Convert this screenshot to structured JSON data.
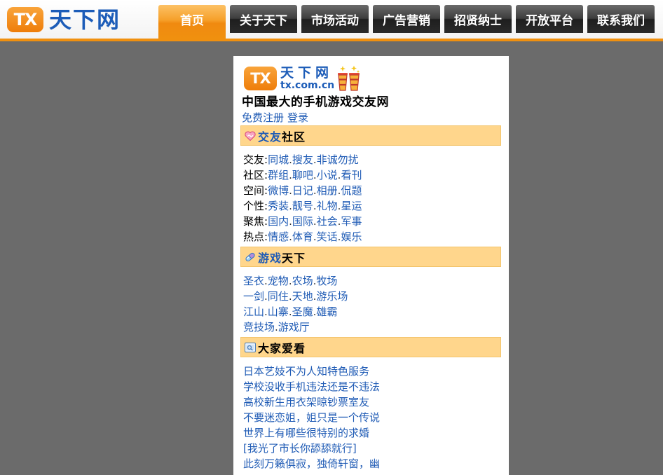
{
  "site": {
    "badge": "TX",
    "name": "天下网"
  },
  "nav": [
    {
      "label": "首页",
      "active": true
    },
    {
      "label": "关于天下"
    },
    {
      "label": "市场活动"
    },
    {
      "label": "广告营销"
    },
    {
      "label": "招贤纳士"
    },
    {
      "label": "开放平台"
    },
    {
      "label": "联系我们"
    }
  ],
  "wap": {
    "logo": {
      "badge": "TX",
      "name": "天下网",
      "domain": "tx.com.cn",
      "icon": "drink-cups-icon"
    },
    "tagline": "中国最大的手机游戏交友网",
    "register": "免费注册",
    "login": "登录",
    "separator": ".",
    "sections": [
      {
        "icon": "heart-icon",
        "title_highlight": "交友",
        "title_rest": "社区",
        "rows": [
          {
            "label": "交友:",
            "links": [
              "同城",
              "搜友",
              "非诚勿扰"
            ]
          },
          {
            "label": "社区:",
            "links": [
              "群组",
              "聊吧",
              "小说",
              "看刊"
            ]
          },
          {
            "label": "空间:",
            "links": [
              "微博",
              "日记",
              "相册",
              "侃题"
            ]
          },
          {
            "label": "个性:",
            "links": [
              "秀装",
              "靓号",
              "礼物",
              "星运"
            ]
          },
          {
            "label": "聚焦:",
            "links": [
              "国内",
              "国际",
              "社会",
              "军事"
            ]
          },
          {
            "label": "热点:",
            "links": [
              "情感",
              "体育",
              "笑话",
              "娱乐"
            ]
          }
        ]
      },
      {
        "icon": "capsule-icon",
        "title_highlight": "游戏",
        "title_rest": "天下",
        "rows": [
          {
            "links": [
              "圣衣",
              "宠物",
              "农场",
              "牧场"
            ]
          },
          {
            "links": [
              "一剑",
              "同住",
              "天地",
              "游乐场"
            ]
          },
          {
            "links": [
              "江山",
              "山寨",
              "圣魔",
              "雄霸"
            ]
          },
          {
            "links": [
              "竞技场",
              "游戏厅"
            ]
          }
        ]
      },
      {
        "icon": "screen-icon",
        "title_rest": "大家爱看",
        "items": [
          "日本艺妓不为人知特色服务",
          "学校没收手机违法还是不违法",
          "高校新生用衣架晾钞票室友",
          "不要迷恋姐，姐只是一个传说",
          "世界上有哪些很特别的求婚",
          "[我光了市长你舔舔就行]",
          "此刻万籁俱寂，独倚轩窗，幽"
        ]
      }
    ]
  },
  "colors": {
    "accent_orange": "#f0900f",
    "brand_blue": "#1c5cb8",
    "link_blue": "#1f5bb5",
    "section_bg": "#ffd68c",
    "page_bg": "#6b6b6b",
    "nav_dark": "#2a2a2a"
  }
}
